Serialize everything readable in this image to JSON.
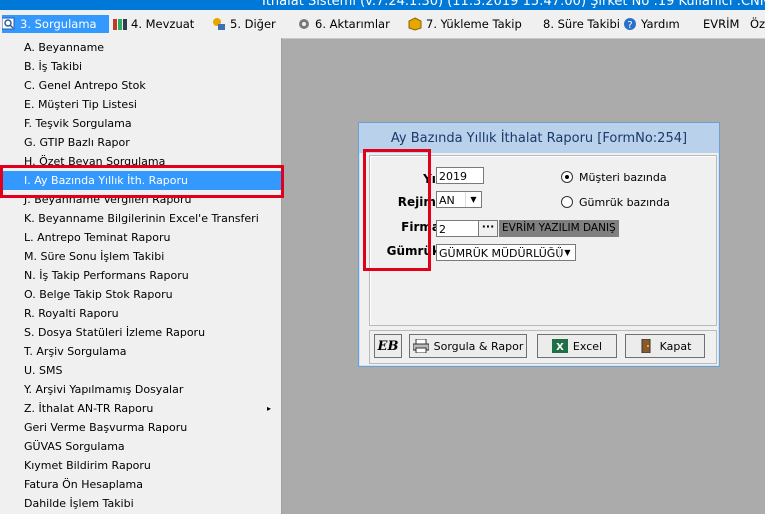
{
  "window": {
    "title": "İthalat Sistemi (v.7.24.1.30) (11.3.2019 15:47:00) Şirket No :19 Kullanıcı :CNN S"
  },
  "menubar": {
    "items": [
      {
        "label": "3.  Sorgulama",
        "icon": "magnifier-icon",
        "active": true
      },
      {
        "label": "4.  Mevzuat",
        "icon": "books-icon"
      },
      {
        "label": "5.  Diğer",
        "icon": "tools-icon"
      },
      {
        "label": "6.  Aktarımlar",
        "icon": "gear-icon"
      },
      {
        "label": "7.  Yükleme Takip",
        "icon": "cube-icon"
      },
      {
        "label": "8. Süre Takibi"
      },
      {
        "label": "Yardım",
        "icon": "help-icon"
      },
      {
        "label": "EVRİM"
      },
      {
        "label": "Öz"
      }
    ]
  },
  "dropdown": {
    "items": [
      "A.  Beyanname",
      "B.  İş Takibi",
      "C.  Genel Antrepo Stok",
      "E.  Müşteri Tip Listesi",
      "F.  Teşvik Sorgulama",
      "G.  GTIP Bazlı Rapor",
      "H.  Özet Beyan Sorgulama",
      "I.  Ay Bazında Yıllık İth. Raporu",
      "J.  Beyanname Vergileri Raporu",
      "K.  Beyanname Bilgilerinin Excel'e Transferi",
      "L.  Antrepo Teminat Raporu",
      "M.  Süre Sonu İşlem Takibi",
      "N.  İş Takip Performans Raporu",
      "O.  Belge Takip Stok Raporu",
      "R.  Royalti Raporu",
      "S.  Dosya Statüleri İzleme Raporu",
      "T.  Arşiv Sorgulama",
      "U.  SMS",
      "Y.  Arşivi Yapılmamış Dosyalar",
      "Z.  İthalat AN-TR Raporu",
      "Geri Verme Başvurma Raporu",
      "GÜVAS Sorgulama",
      "Kıymet Bildirim Raporu",
      "Fatura Ön Hesaplama",
      "Dahilde İşlem Takibi"
    ],
    "selected_index": 7,
    "submenu_arrow": "▸"
  },
  "dialog": {
    "title": "Ay Bazında Yıllık İthalat Raporu [FormNo:254]",
    "fields": {
      "yil_label": "Yıl",
      "yil_value": "2019",
      "rejim_label": "Rejimi",
      "rejim_value": "AN",
      "firma_label": "Firma",
      "firma_value": "2",
      "firma_lookup": "···",
      "firma_name": "EVRİM YAZILIM DANIŞ",
      "gumruk_label": "Gümrük",
      "gumruk_value": "GÜMRÜK MÜDÜRLÜĞÜ"
    },
    "radios": [
      {
        "label": "Müşteri bazında",
        "checked": true
      },
      {
        "label": "Gümrük bazında",
        "checked": false
      }
    ],
    "buttons": {
      "logo": "EB",
      "sorgula": "Sorgula & Rapor",
      "excel": "Excel",
      "kapat": "Kapat"
    }
  },
  "colors": {
    "accent": "#3399ff",
    "highlight": "#e0001b",
    "dialog_title_bg": "#b9d1ea",
    "desktop": "#ababab"
  }
}
